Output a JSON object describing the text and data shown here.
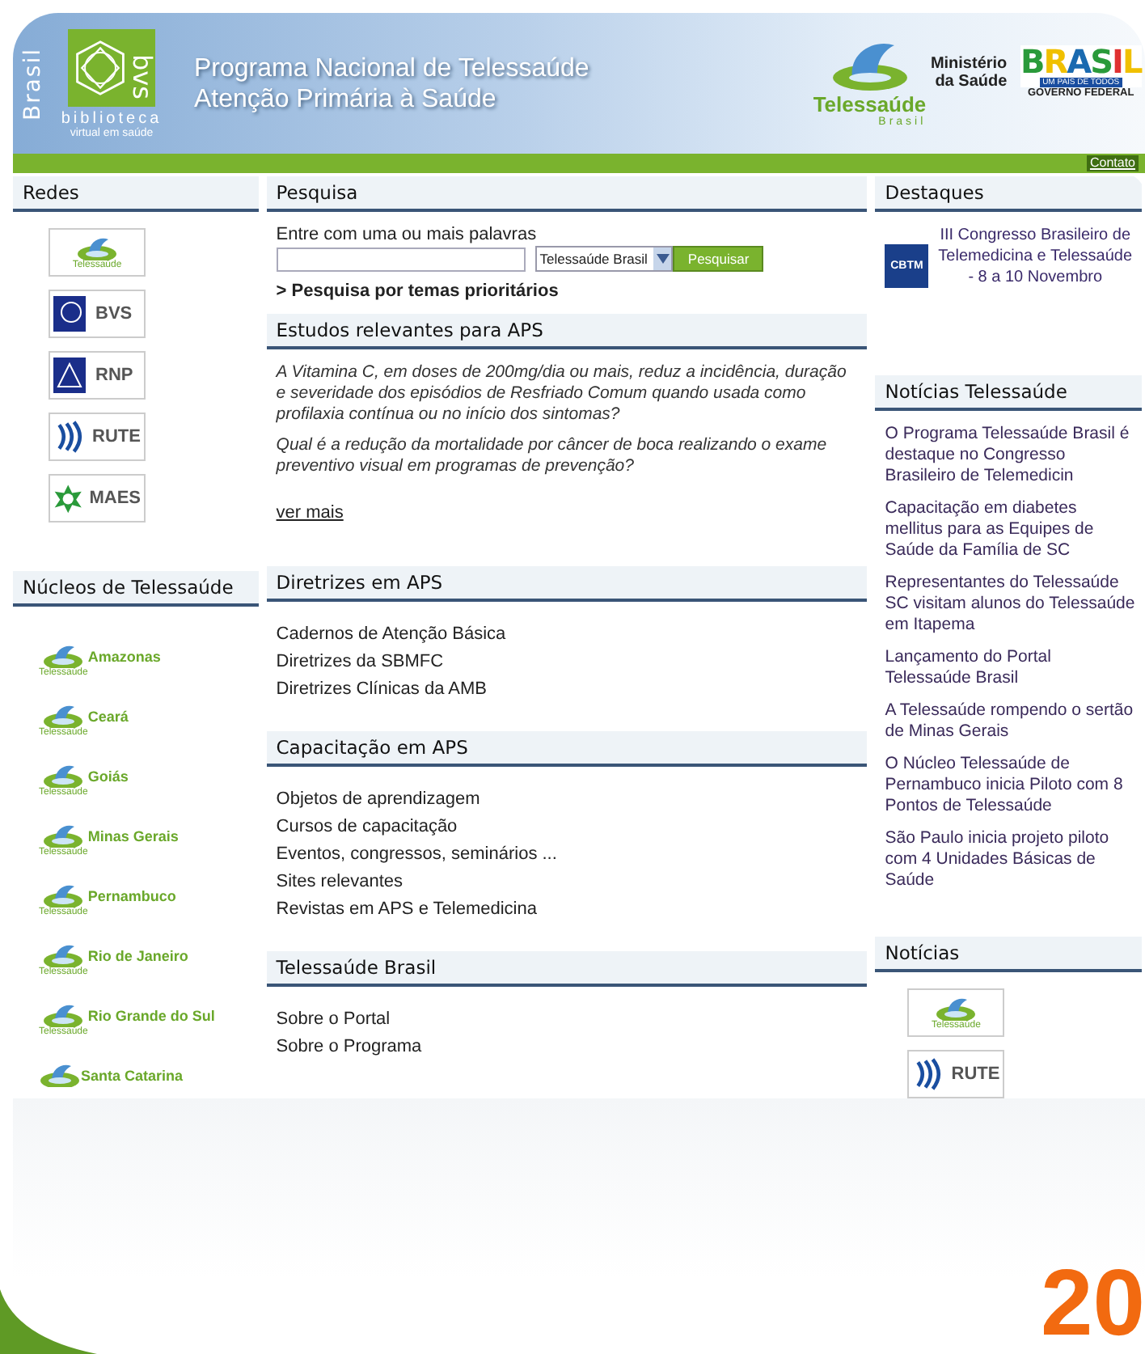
{
  "header": {
    "brand_vertical": "Brasil",
    "bvs_logo": {
      "acronym": "bvs",
      "line1": "biblioteca",
      "line2": "virtual em saúde"
    },
    "title_lines": [
      "Programa Nacional de Telessaúde",
      "Atenção Primária à Saúde"
    ],
    "telessaude_logo": {
      "name": "Telessaúde",
      "sub": "Brasil"
    },
    "ministry": [
      "Ministério",
      "da Saúde"
    ],
    "gov_logo": {
      "word": "BRASIL",
      "tagline": "UM PAÍS DE TODOS",
      "footer": "GOVERNO FEDERAL"
    }
  },
  "contact_link": "Contato",
  "left": {
    "networks": {
      "title": "Redes",
      "items": [
        {
          "kind": "telessaude",
          "label": "Telessaúde"
        },
        {
          "kind": "bvs",
          "label": "BVS"
        },
        {
          "kind": "rnp",
          "label": "RNP"
        },
        {
          "kind": "rute",
          "label": "RUTE"
        },
        {
          "kind": "maes",
          "label": "MAES"
        }
      ]
    },
    "nucleos": {
      "title": "Núcleos de Telessaúde",
      "items": [
        {
          "name": "Amazonas",
          "logo_text": "Telessaúde"
        },
        {
          "name": "Ceará",
          "logo_text": "Telessaúde"
        },
        {
          "name": "Goiás",
          "logo_text": "Telessaúde"
        },
        {
          "name": "Minas Gerais",
          "logo_text": "Telessaúde"
        },
        {
          "name": "Pernambuco",
          "logo_text": "Telessaúde"
        },
        {
          "name": "Rio de Janeiro",
          "logo_text": "Telessaúde"
        },
        {
          "name": "Rio Grande do Sul",
          "logo_text": "Telessaúde"
        },
        {
          "name": "Santa Catarina"
        }
      ]
    }
  },
  "middle": {
    "search": {
      "title": "Pesquisa",
      "label": "Entre com uma ou mais palavras",
      "select": "Telessaúde Brasil",
      "button": "Pesquisar",
      "priority_link": "> Pesquisa por temas prioritários"
    },
    "studies": {
      "title": "Estudos relevantes para APS",
      "items": [
        "A Vitamina C, em doses de 200mg/dia ou mais, reduz a incidência, duração e severidade dos episódios de Resfriado Comum quando usada como profilaxia contínua ou no início dos sintomas?",
        "Qual é a redução da mortalidade por câncer de boca realizando o exame preventivo visual em programas de prevenção?"
      ],
      "more": "ver mais"
    },
    "sections": [
      {
        "title": "Diretrizes em APS",
        "links": [
          "Cadernos de Atenção Básica",
          "Diretrizes da SBMFC",
          "Diretrizes Clínicas da AMB"
        ]
      },
      {
        "title": "Capacitação em APS",
        "links": [
          "Objetos de aprendizagem",
          "Cursos de capacitação",
          "Eventos, congressos, seminários ...",
          "Sites relevantes",
          "Revistas em APS e Telemedicina"
        ]
      },
      {
        "title": "Telessaúde Brasil",
        "links": [
          "Sobre o Portal",
          "Sobre o Programa"
        ]
      }
    ]
  },
  "right": {
    "highlights": {
      "title": "Destaques",
      "items": [
        {
          "logo": "CBTM",
          "text": "III Congresso Brasileiro de Telemedicina e Telessaúde - 8 a 10 Novembro"
        }
      ]
    },
    "news": {
      "title": "Notícias Telessaúde",
      "items": [
        "O Programa Telessaúde Brasil é destaque no Congresso Brasileiro de Telemedicin",
        "Capacitação em diabetes mellitus para as Equipes de Saúde da Família de SC",
        "Representantes do Telessaúde SC visitam alunos do Telessaúde em Itapema",
        "Lançamento do Portal Telessaúde Brasil",
        "A Telessaúde rompendo o sertão de Minas Gerais",
        "O Núcleo Telessaúde de Pernambuco inicia Piloto com 8 Pontos de Telessaúde",
        "São Paulo inicia projeto piloto com 4 Unidades Básicas de Saúde"
      ]
    },
    "noticias": {
      "title": "Notícias",
      "items": [
        {
          "kind": "telessaude",
          "label": "Telessaúde"
        },
        {
          "kind": "rute",
          "label": "RUTE"
        }
      ]
    }
  },
  "corner_mark": "20"
}
